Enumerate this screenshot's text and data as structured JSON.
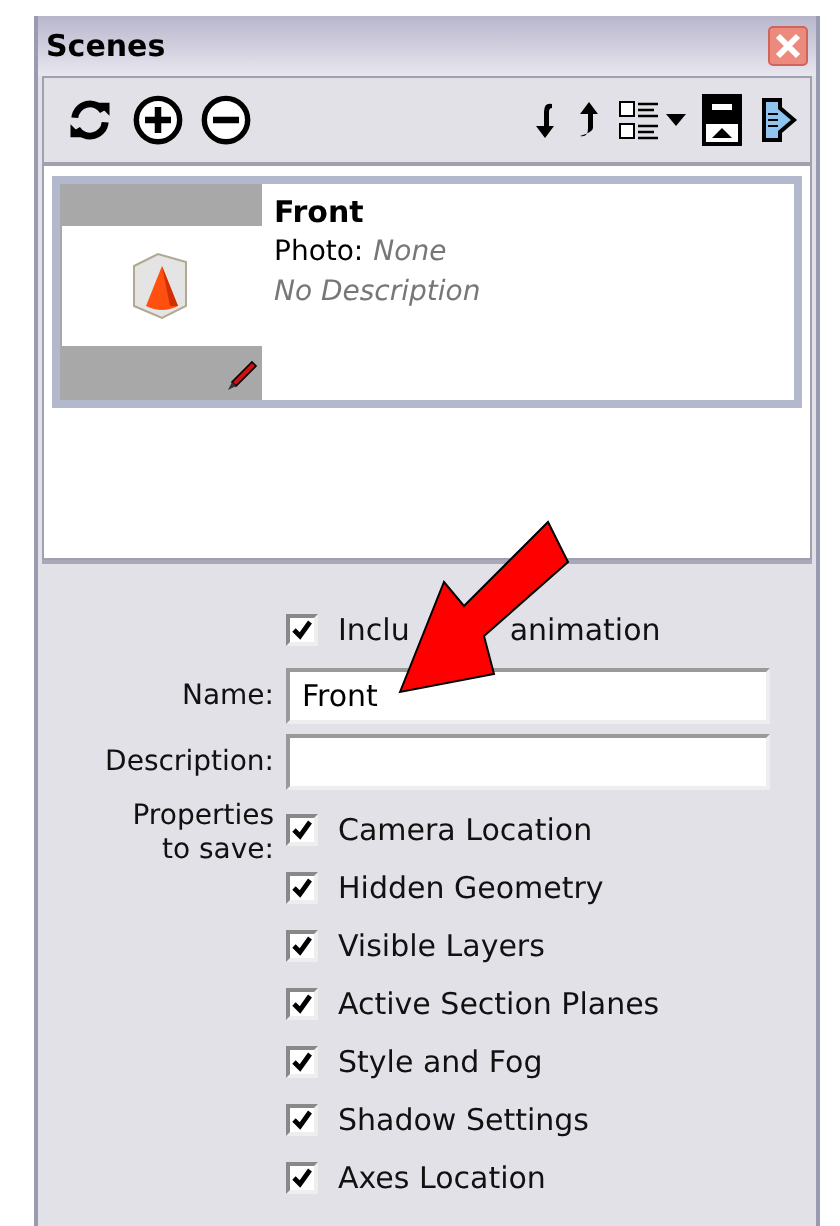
{
  "window": {
    "title": "Scenes"
  },
  "scenes": [
    {
      "name": "Front",
      "photo_label": "Photo:",
      "photo_value": "None",
      "description": "No Description",
      "selected": true
    }
  ],
  "include_in_animation": {
    "label_parts": [
      "Inclu",
      "animation"
    ],
    "checked": true
  },
  "fields": [
    {
      "label": "Name:",
      "value": "Front"
    },
    {
      "label": "Description:"
    }
  ],
  "properties": {
    "label": "Properties to save:",
    "items": [
      {
        "label": "Camera Location",
        "checked": true
      },
      {
        "label": "Hidden Geometry",
        "checked": true
      },
      {
        "label": "Visible Layers",
        "checked": true
      },
      {
        "label": "Active Section Planes",
        "checked": true
      },
      {
        "label": "Style and Fog",
        "checked": true
      },
      {
        "label": "Shadow Settings",
        "checked": true
      },
      {
        "label": "Axes Location",
        "checked": true
      }
    ]
  }
}
